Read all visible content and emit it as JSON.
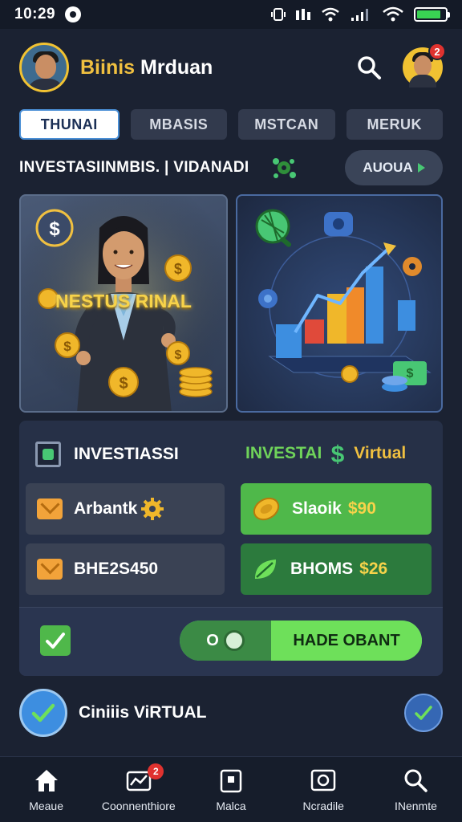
{
  "status_bar": {
    "time": "10:29"
  },
  "header": {
    "title_part1": "Biinis",
    "title_part2": "Mrduan",
    "notification_count": "2"
  },
  "tabs": [
    {
      "label": "THUNAI",
      "active": true
    },
    {
      "label": "MBASIS",
      "active": false
    },
    {
      "label": "MSTCAN",
      "active": false
    },
    {
      "label": "MERUK",
      "active": false
    }
  ],
  "subheader": {
    "title": "INVESTASIINMBIS. | VIDANADI",
    "button_label": "AUOUA"
  },
  "hero": {
    "left_text": "NESTUS RINAL"
  },
  "panel": {
    "left_title": "INVESTIASSI",
    "right_title_part1": "INVESTAI",
    "right_title_part2": "Virtual",
    "left_items": [
      {
        "label": "Arbantk"
      },
      {
        "label": "BHE2S450"
      }
    ],
    "right_items": [
      {
        "label": "Slaoik",
        "value": "$90"
      },
      {
        "label": "BHOMS",
        "value": "$26"
      }
    ],
    "toggle_left": "O",
    "toggle_label": "HADE OBANT"
  },
  "confirm": {
    "label": "Ciniiis ViRTUAL"
  },
  "bottom_nav": [
    {
      "label": "Meaue",
      "icon": "home-icon"
    },
    {
      "label": "Coonnenthiore",
      "icon": "chart-icon",
      "badge": "2"
    },
    {
      "label": "Malca",
      "icon": "wallet-icon"
    },
    {
      "label": "Ncradile",
      "icon": "camera-icon"
    },
    {
      "label": "INenmte",
      "icon": "search-icon"
    }
  ],
  "colors": {
    "accent_gold": "#f0c040",
    "accent_green": "#48c774",
    "background": "#1b2232"
  }
}
